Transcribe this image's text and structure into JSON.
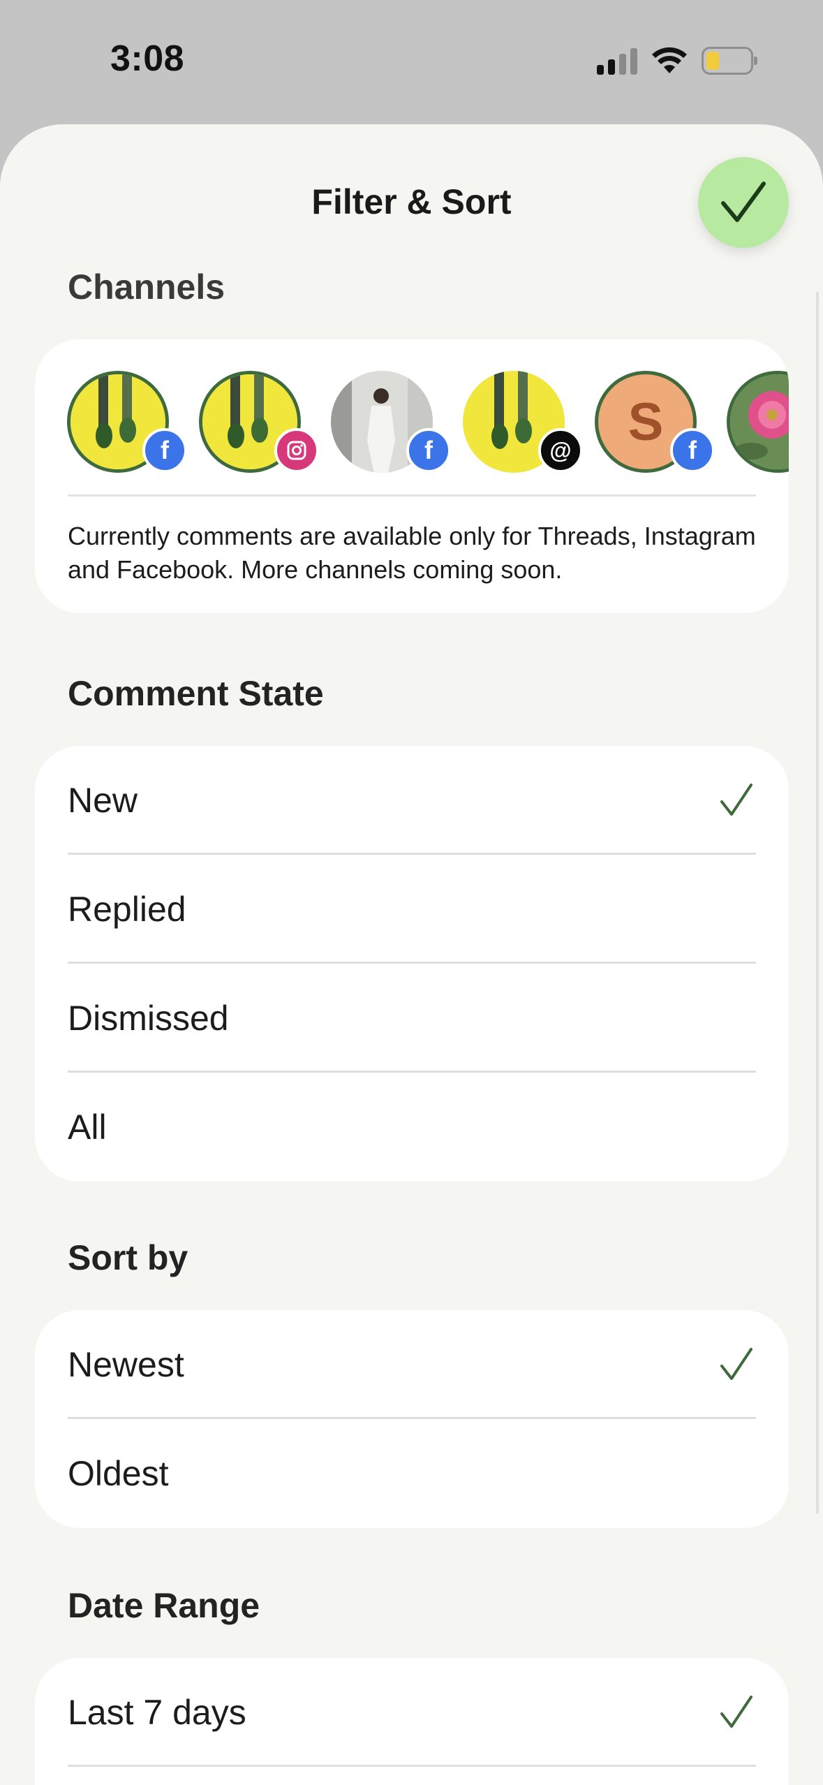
{
  "status_bar": {
    "time": "3:08"
  },
  "header": {
    "title": "Filter & Sort",
    "done_icon": "checkmark-icon"
  },
  "channels": {
    "label": "Channels",
    "items": [
      {
        "image": "yellow-sneakers",
        "platform": "facebook",
        "ring": true
      },
      {
        "image": "yellow-sneakers",
        "platform": "instagram",
        "ring": true
      },
      {
        "image": "person-white-outfit",
        "platform": "facebook",
        "ring": false
      },
      {
        "image": "yellow-sneakers",
        "platform": "threads",
        "ring": false
      },
      {
        "image": "letter-s",
        "letter": "S",
        "platform": "facebook",
        "ring": true
      },
      {
        "image": "pink-flower",
        "platform": "",
        "ring": true
      }
    ],
    "note": "Currently comments are available only for Threads, Instagram and Facebook. More channels coming soon."
  },
  "comment_state": {
    "label": "Comment State",
    "options": [
      {
        "label": "New",
        "selected": true
      },
      {
        "label": "Replied",
        "selected": false
      },
      {
        "label": "Dismissed",
        "selected": false
      },
      {
        "label": "All",
        "selected": false
      }
    ]
  },
  "sort_by": {
    "label": "Sort by",
    "options": [
      {
        "label": "Newest",
        "selected": true
      },
      {
        "label": "Oldest",
        "selected": false
      }
    ]
  },
  "date_range": {
    "label": "Date Range",
    "options": [
      {
        "label": "Last 7 days",
        "selected": true
      }
    ]
  },
  "colors": {
    "accent": "#3f6a3c",
    "done_bg": "#b7eaa0",
    "facebook": "#3b73e8",
    "instagram": "#d6387a",
    "threads": "#0b0b0b"
  }
}
